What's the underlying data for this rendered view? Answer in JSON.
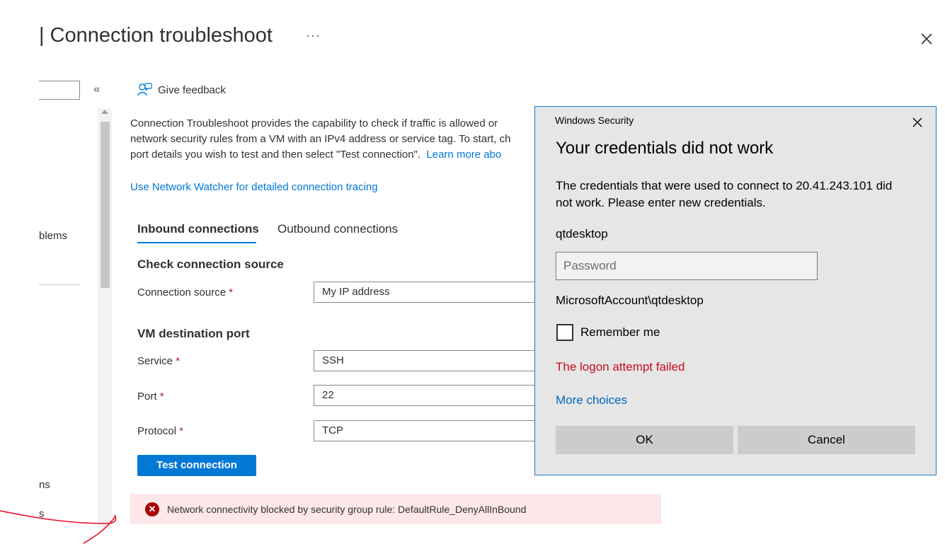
{
  "header": {
    "title": "| Connection troubleshoot",
    "more_label": "···"
  },
  "sidebar": {
    "collapse_label": "«",
    "visible_items": [
      "blems",
      "ns",
      "s"
    ]
  },
  "toolbar": {
    "feedback_label": "Give feedback"
  },
  "description": {
    "line1": "Connection Troubleshoot provides the capability to check if traffic is allowed or",
    "line2": "network security rules from a VM with an IPv4 address or service tag. To start, ch",
    "line3": "port details you wish to test and then select \"Test connection\".",
    "learn_more": "Learn more abo"
  },
  "watcher_link": "Use Network Watcher for detailed connection tracing",
  "tabs": [
    {
      "label": "Inbound connections",
      "active": true
    },
    {
      "label": "Outbound connections",
      "active": false
    }
  ],
  "form": {
    "source_section": "Check connection source",
    "source_label": "Connection source",
    "source_value": "My IP address",
    "dest_section": "VM destination port",
    "service_label": "Service",
    "service_value": "SSH",
    "port_label": "Port",
    "port_value": "22",
    "protocol_label": "Protocol",
    "protocol_value": "TCP",
    "required_mark": "*",
    "test_button": "Test connection"
  },
  "result": {
    "error_text": "Network connectivity blocked by security group rule: DefaultRule_DenyAllInBound"
  },
  "dialog": {
    "window_title": "Windows Security",
    "heading": "Your credentials did not work",
    "message_line1": "The credentials that were used to connect to 20.41.243.101 did",
    "message_line2": "not work. Please enter new credentials.",
    "username": "qtdesktop",
    "password_placeholder": "Password",
    "domain_user": "MicrosoftAccount\\qtdesktop",
    "remember_label": "Remember me",
    "error": "The logon attempt failed",
    "more_choices": "More choices",
    "ok_label": "OK",
    "cancel_label": "Cancel"
  },
  "colors": {
    "accent": "#0078d4",
    "error_bg": "#fde7e9",
    "error_icon": "#a80000",
    "dialog_bg": "#e6e6e6",
    "dialog_error": "#c50f1f",
    "annotation": "#e8112d"
  }
}
